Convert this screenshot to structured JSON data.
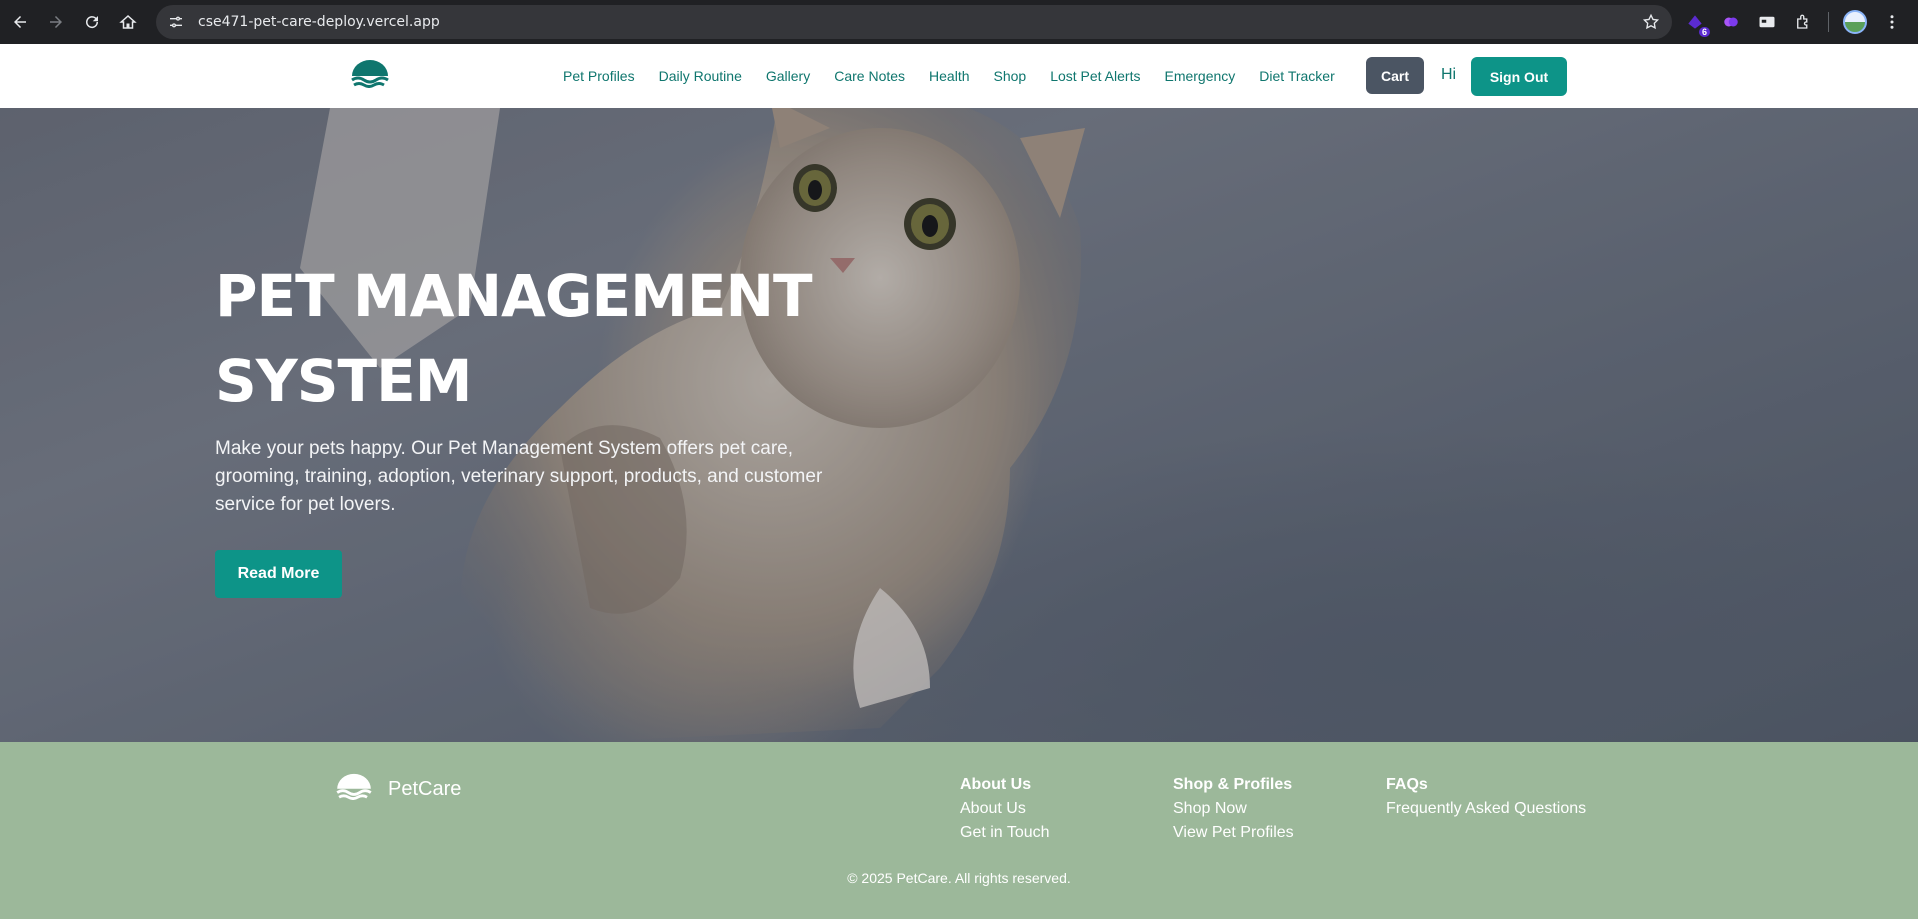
{
  "browser": {
    "url": "cse471-pet-care-deploy.vercel.app",
    "extension_badge": "6"
  },
  "header": {
    "nav": [
      "Pet Profiles",
      "Daily Routine",
      "Gallery",
      "Care Notes",
      "Health",
      "Shop",
      "Lost Pet Alerts",
      "Emergency",
      "Diet Tracker"
    ],
    "cart_label": "Cart",
    "greeting": "Hi",
    "signout_label": "Sign Out"
  },
  "hero": {
    "title_line1": "PET MANAGEMENT",
    "title_line2": "SYSTEM",
    "description": "Make your pets happy. Our Pet Management System offers pet care, grooming, training, adoption, veterinary support, products, and customer service for pet lovers.",
    "cta_label": "Read More"
  },
  "footer": {
    "brand": "PetCare",
    "col1": {
      "heading": "About Us",
      "links": [
        "About Us",
        "Get in Touch"
      ]
    },
    "col2": {
      "heading": "Shop & Profiles",
      "links": [
        "Shop Now",
        "View Pet Profiles"
      ]
    },
    "col3": {
      "heading": "FAQs",
      "links": [
        "Frequently Asked Questions"
      ]
    },
    "copyright": "© 2025 PetCare. All rights reserved."
  },
  "colors": {
    "brand_teal": "#0d9488",
    "nav_text": "#0f766e",
    "cart_bg": "#4b5563",
    "footer_bg": "#9cb89a"
  }
}
